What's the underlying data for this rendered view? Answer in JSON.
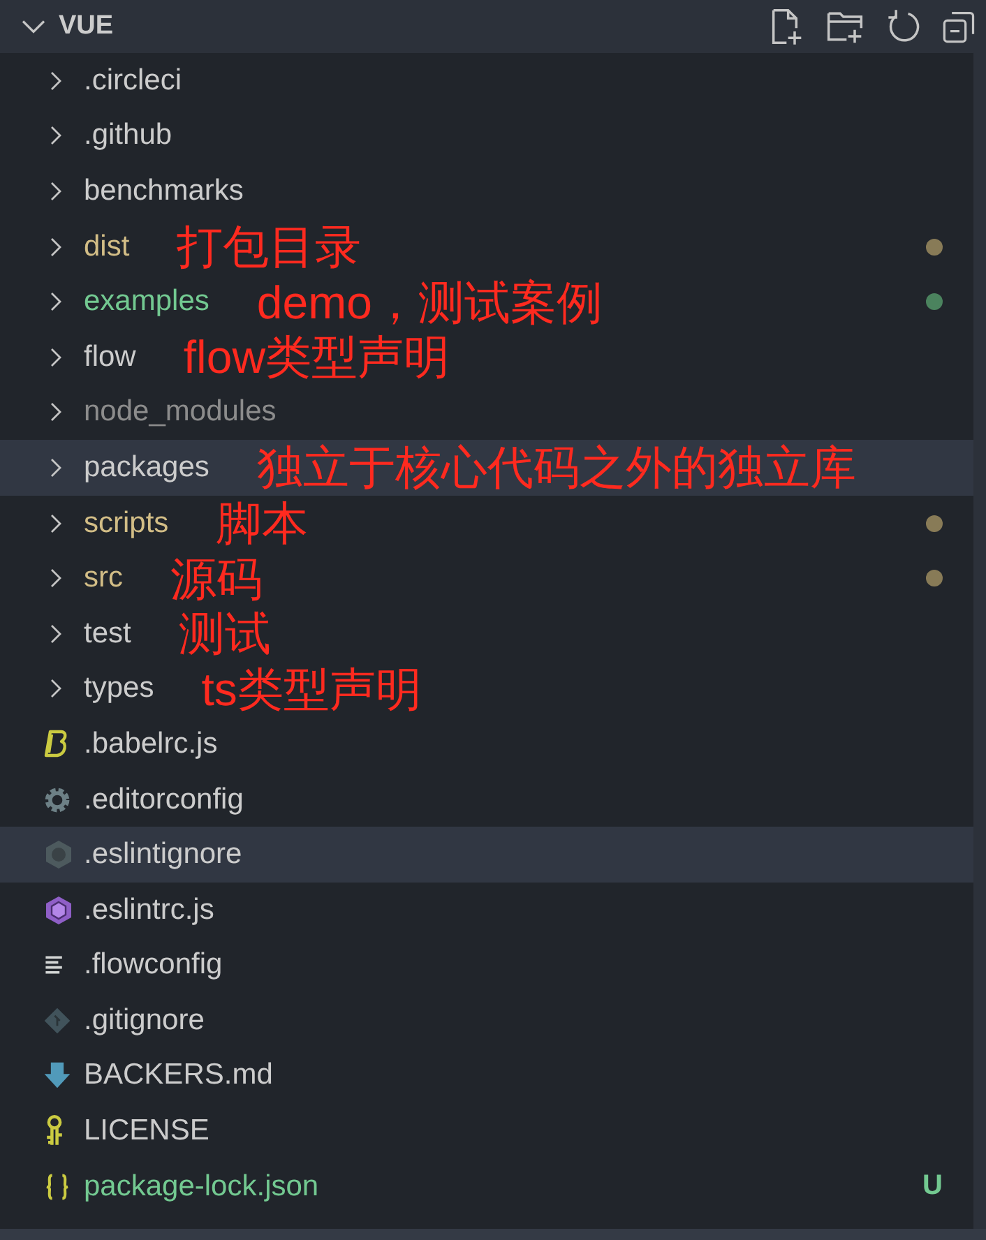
{
  "explorer": {
    "title": "VUE",
    "expanded": true
  },
  "items": [
    {
      "kind": "folder",
      "name": ".circleci",
      "color": "#cccccc",
      "dot": false,
      "selected": false
    },
    {
      "kind": "folder",
      "name": ".github",
      "color": "#cccccc",
      "dot": false,
      "selected": false
    },
    {
      "kind": "folder",
      "name": "benchmarks",
      "color": "#cccccc",
      "dot": false,
      "selected": false
    },
    {
      "kind": "folder",
      "name": "dist",
      "color": "#d2bd86",
      "dot": true,
      "selected": false,
      "note": "打包目录"
    },
    {
      "kind": "folder",
      "name": "examples",
      "color": "#73c991",
      "dot": true,
      "selected": false,
      "note": "demo，测试案例"
    },
    {
      "kind": "folder",
      "name": "flow",
      "color": "#cccccc",
      "dot": false,
      "selected": false,
      "note": "flow类型声明"
    },
    {
      "kind": "folder",
      "name": "node_modules",
      "color": "#8c8c8c",
      "dot": false,
      "selected": false
    },
    {
      "kind": "folder",
      "name": "packages",
      "color": "#cccccc",
      "dot": false,
      "selected": true,
      "note": "独立于核心代码之外的独立库"
    },
    {
      "kind": "folder",
      "name": "scripts",
      "color": "#d2bd86",
      "dot": true,
      "selected": false,
      "note": "脚本"
    },
    {
      "kind": "folder",
      "name": "src",
      "color": "#d2bd86",
      "dot": true,
      "selected": false,
      "note": "源码"
    },
    {
      "kind": "folder",
      "name": "test",
      "color": "#cccccc",
      "dot": false,
      "selected": false,
      "note": "测试"
    },
    {
      "kind": "folder",
      "name": "types",
      "color": "#cccccc",
      "dot": false,
      "selected": false,
      "note": "ts类型声明"
    },
    {
      "kind": "file",
      "name": ".babelrc.js",
      "color": "#cccccc",
      "dot": false,
      "selected": false
    },
    {
      "kind": "file",
      "name": ".editorconfig",
      "color": "#cccccc",
      "dot": false,
      "selected": false
    },
    {
      "kind": "file",
      "name": ".eslintignore",
      "color": "#cccccc",
      "dot": false,
      "selected": true
    },
    {
      "kind": "file",
      "name": ".eslintrc.js",
      "color": "#cccccc",
      "dot": false,
      "selected": false
    },
    {
      "kind": "file",
      "name": ".flowconfig",
      "color": "#cccccc",
      "dot": false,
      "selected": false
    },
    {
      "kind": "file",
      "name": ".gitignore",
      "color": "#cccccc",
      "dot": false,
      "selected": false
    },
    {
      "kind": "file",
      "name": "BACKERS.md",
      "color": "#cccccc",
      "dot": false,
      "selected": false
    },
    {
      "kind": "file",
      "name": "LICENSE",
      "color": "#cccccc",
      "dot": false,
      "selected": false
    },
    {
      "kind": "file",
      "name": "package-lock.json",
      "color": "#73c991",
      "dot": false,
      "selected": false,
      "badge": "U"
    }
  ]
}
